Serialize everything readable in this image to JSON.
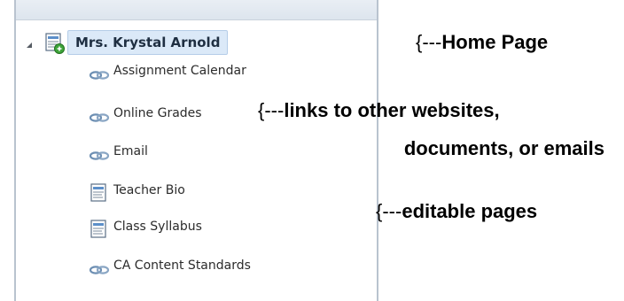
{
  "tree": {
    "root": {
      "label": "Mrs. Krystal Arnold",
      "icon": "home-page-icon"
    },
    "items": [
      {
        "label": "Assignment Calendar",
        "icon": "link-icon"
      },
      {
        "label": "Online Grades",
        "icon": "link-icon"
      },
      {
        "label": "Email",
        "icon": "link-icon"
      },
      {
        "label": "Teacher Bio",
        "icon": "page-icon"
      },
      {
        "label": "Class Syllabus",
        "icon": "page-icon"
      },
      {
        "label": "CA Content Standards",
        "icon": "link-icon"
      }
    ]
  },
  "annotations": {
    "home": {
      "brace": "{---",
      "text": "Home Page"
    },
    "links": {
      "brace": "{---",
      "line1": "links to other websites,",
      "line2": "documents, or emails"
    },
    "editable": {
      "brace": "{---",
      "text": "editable pages"
    }
  }
}
